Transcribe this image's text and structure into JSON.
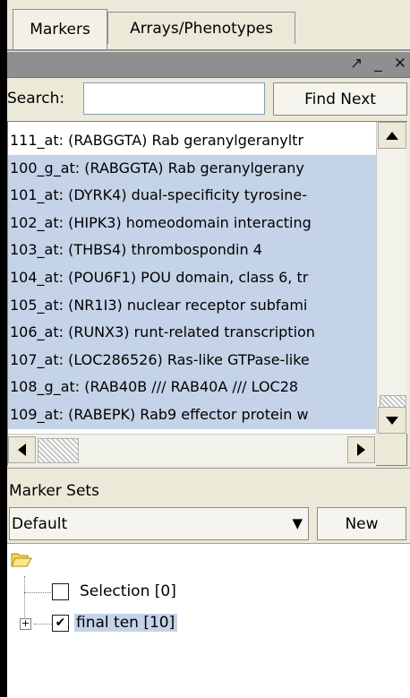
{
  "tabs": [
    {
      "label": "Markers",
      "active": true
    },
    {
      "label": "Arrays/Phenotypes",
      "active": false
    }
  ],
  "titlebar": {
    "icons": [
      "undock-icon",
      "minimize-icon",
      "close-icon"
    ],
    "undock_glyph": "↗",
    "minimize_glyph": "_",
    "close_glyph": "✕"
  },
  "search": {
    "label": "Search:",
    "value": "",
    "find_label": "Find Next"
  },
  "markers": {
    "items": [
      {
        "text": "111_at: (RABGGTA) Rab geranylgeranyltr",
        "selected": false
      },
      {
        "text": "100_g_at: (RABGGTA) Rab geranylgerany",
        "selected": true
      },
      {
        "text": "101_at: (DYRK4) dual-specificity tyrosine-",
        "selected": true
      },
      {
        "text": "102_at: (HIPK3) homeodomain interacting",
        "selected": true
      },
      {
        "text": "103_at: (THBS4) thrombospondin 4",
        "selected": true
      },
      {
        "text": "104_at: (POU6F1) POU domain, class 6, tr",
        "selected": true
      },
      {
        "text": "105_at: (NR1I3) nuclear receptor subfami",
        "selected": true
      },
      {
        "text": "106_at: (RUNX3) runt-related transcription",
        "selected": true
      },
      {
        "text": "107_at: (LOC286526) Ras-like GTPase-like",
        "selected": true
      },
      {
        "text": "108_g_at: (RAB40B /// RAB40A /// LOC28",
        "selected": true
      },
      {
        "text": "109_at: (RABEPK) Rab9 effector protein w",
        "selected": true
      }
    ]
  },
  "marker_sets": {
    "label": "Marker Sets",
    "selected_set": "Default",
    "new_label": "New",
    "tree": [
      {
        "label": "Selection [0]",
        "checked": false
      },
      {
        "label": "final ten [10]",
        "checked": true
      }
    ],
    "expander_glyph": "+",
    "check_glyph": "✔",
    "arrow_glyph": "▼"
  },
  "colors": {
    "selection": "#c5d3e8",
    "panel": "#ece9d8",
    "titlebar": "#8f8f8f"
  }
}
